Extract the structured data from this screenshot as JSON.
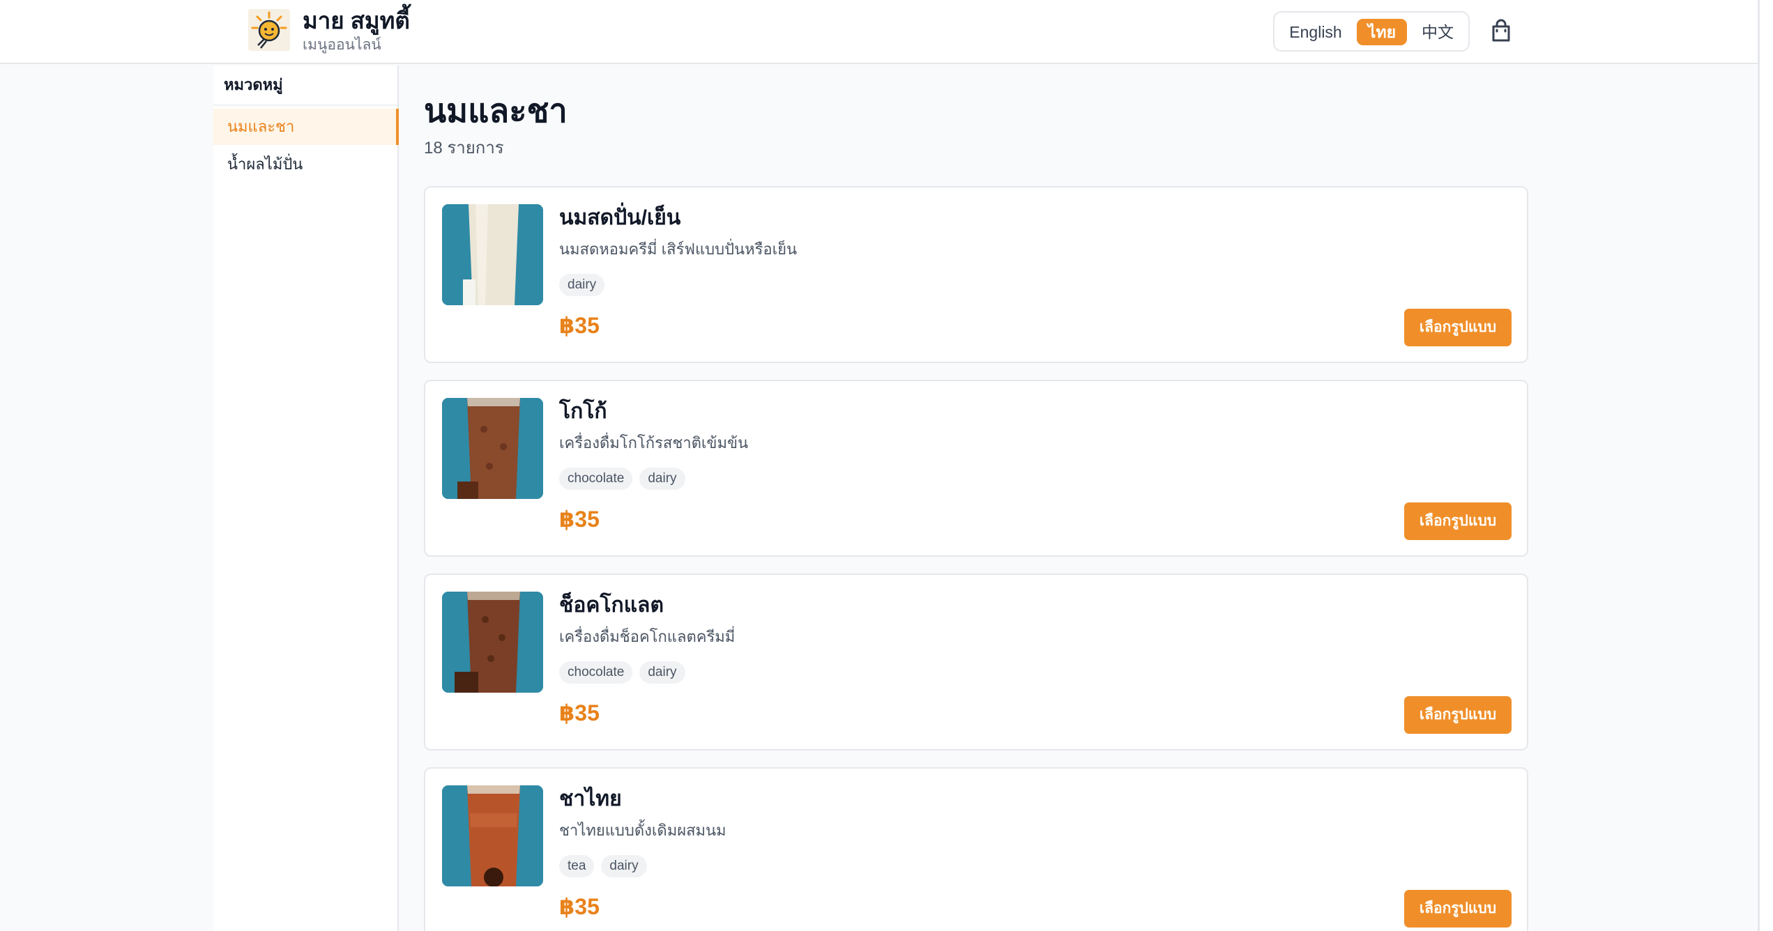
{
  "header": {
    "brand_title": "มาย สมูทตี้",
    "brand_subtitle": "เมนูออนไลน์",
    "languages": [
      "English",
      "ไทย",
      "中文"
    ],
    "active_language": "ไทย",
    "cart_icon": "shopping-bag-icon"
  },
  "sidebar": {
    "heading": "หมวดหมู่",
    "items": [
      {
        "label": "นมและชา",
        "active": true
      },
      {
        "label": "น้ำผลไม้ปั่น",
        "active": false
      }
    ]
  },
  "main": {
    "title": "นมและชา",
    "count": "18 รายการ"
  },
  "products": [
    {
      "name": "นมสดปั่น/เย็น",
      "description": "นมสดหอมครีมี่ เสิร์ฟแบบปั่นหรือเย็น",
      "tags": [
        "dairy"
      ],
      "price": "฿35",
      "button": "เลือกรูปแบบ"
    },
    {
      "name": "โกโก้",
      "description": "เครื่องดื่มโกโก้รสชาติเข้มข้น",
      "tags": [
        "chocolate",
        "dairy"
      ],
      "price": "฿35",
      "button": "เลือกรูปแบบ"
    },
    {
      "name": "ช็อคโกแลต",
      "description": "เครื่องดื่มช็อคโกแลตครีมมี่",
      "tags": [
        "chocolate",
        "dairy"
      ],
      "price": "฿35",
      "button": "เลือกรูปแบบ"
    },
    {
      "name": "ชาไทย",
      "description": "ชาไทยแบบดั้งเดิมผสมนม",
      "tags": [
        "tea",
        "dairy"
      ],
      "price": "฿35",
      "button": "เลือกรูปแบบ"
    }
  ],
  "colors": {
    "accent": "#f08f2a",
    "price": "#e8821a",
    "border": "#e5e7eb",
    "background": "#f9fafb"
  }
}
